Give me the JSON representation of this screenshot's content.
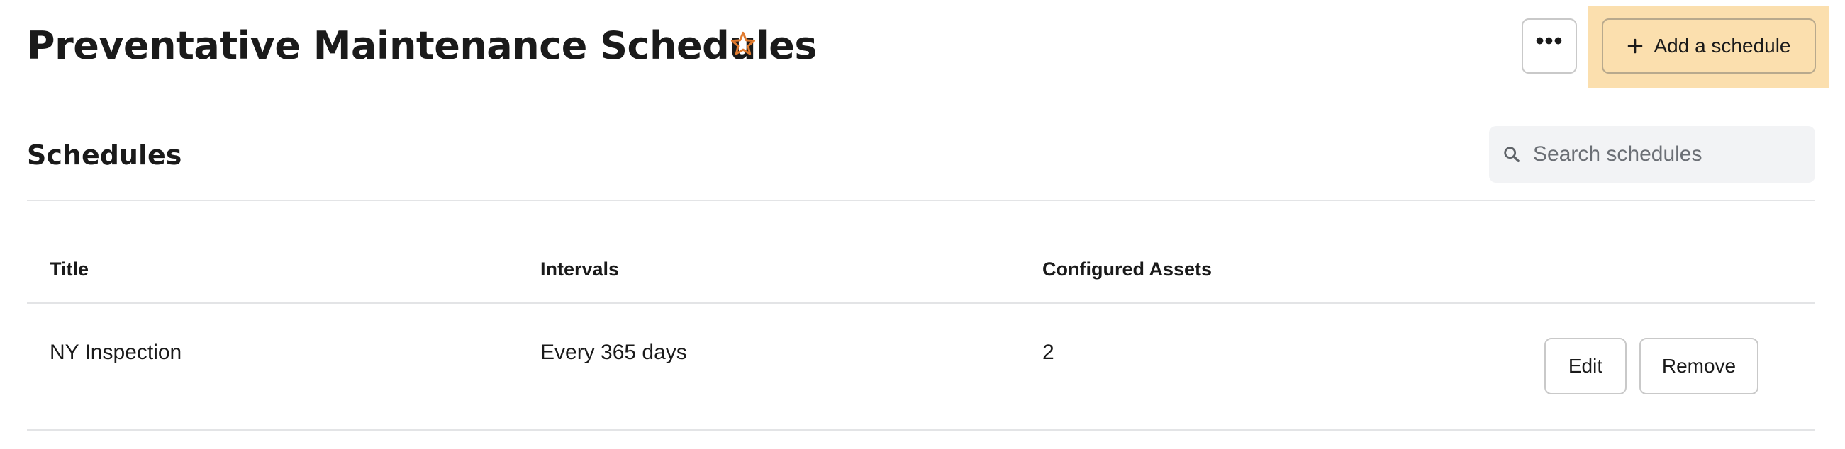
{
  "header": {
    "title": "Preventative Maintenance Schedules",
    "favorite_icon": "star-outline-icon",
    "accent_color": "#e07a2e",
    "more_label": "•••",
    "add_button_label": "Add a schedule",
    "add_button_icon": "plus-icon",
    "add_button_color": "#fbdfae"
  },
  "section": {
    "title": "Schedules",
    "search_placeholder": "Search schedules",
    "search_value": ""
  },
  "table": {
    "columns": [
      "Title",
      "Intervals",
      "Configured Assets"
    ],
    "rows": [
      {
        "title": "NY Inspection",
        "interval": "Every 365 days",
        "configured_assets": "2",
        "actions": [
          "Edit",
          "Remove"
        ]
      }
    ]
  }
}
